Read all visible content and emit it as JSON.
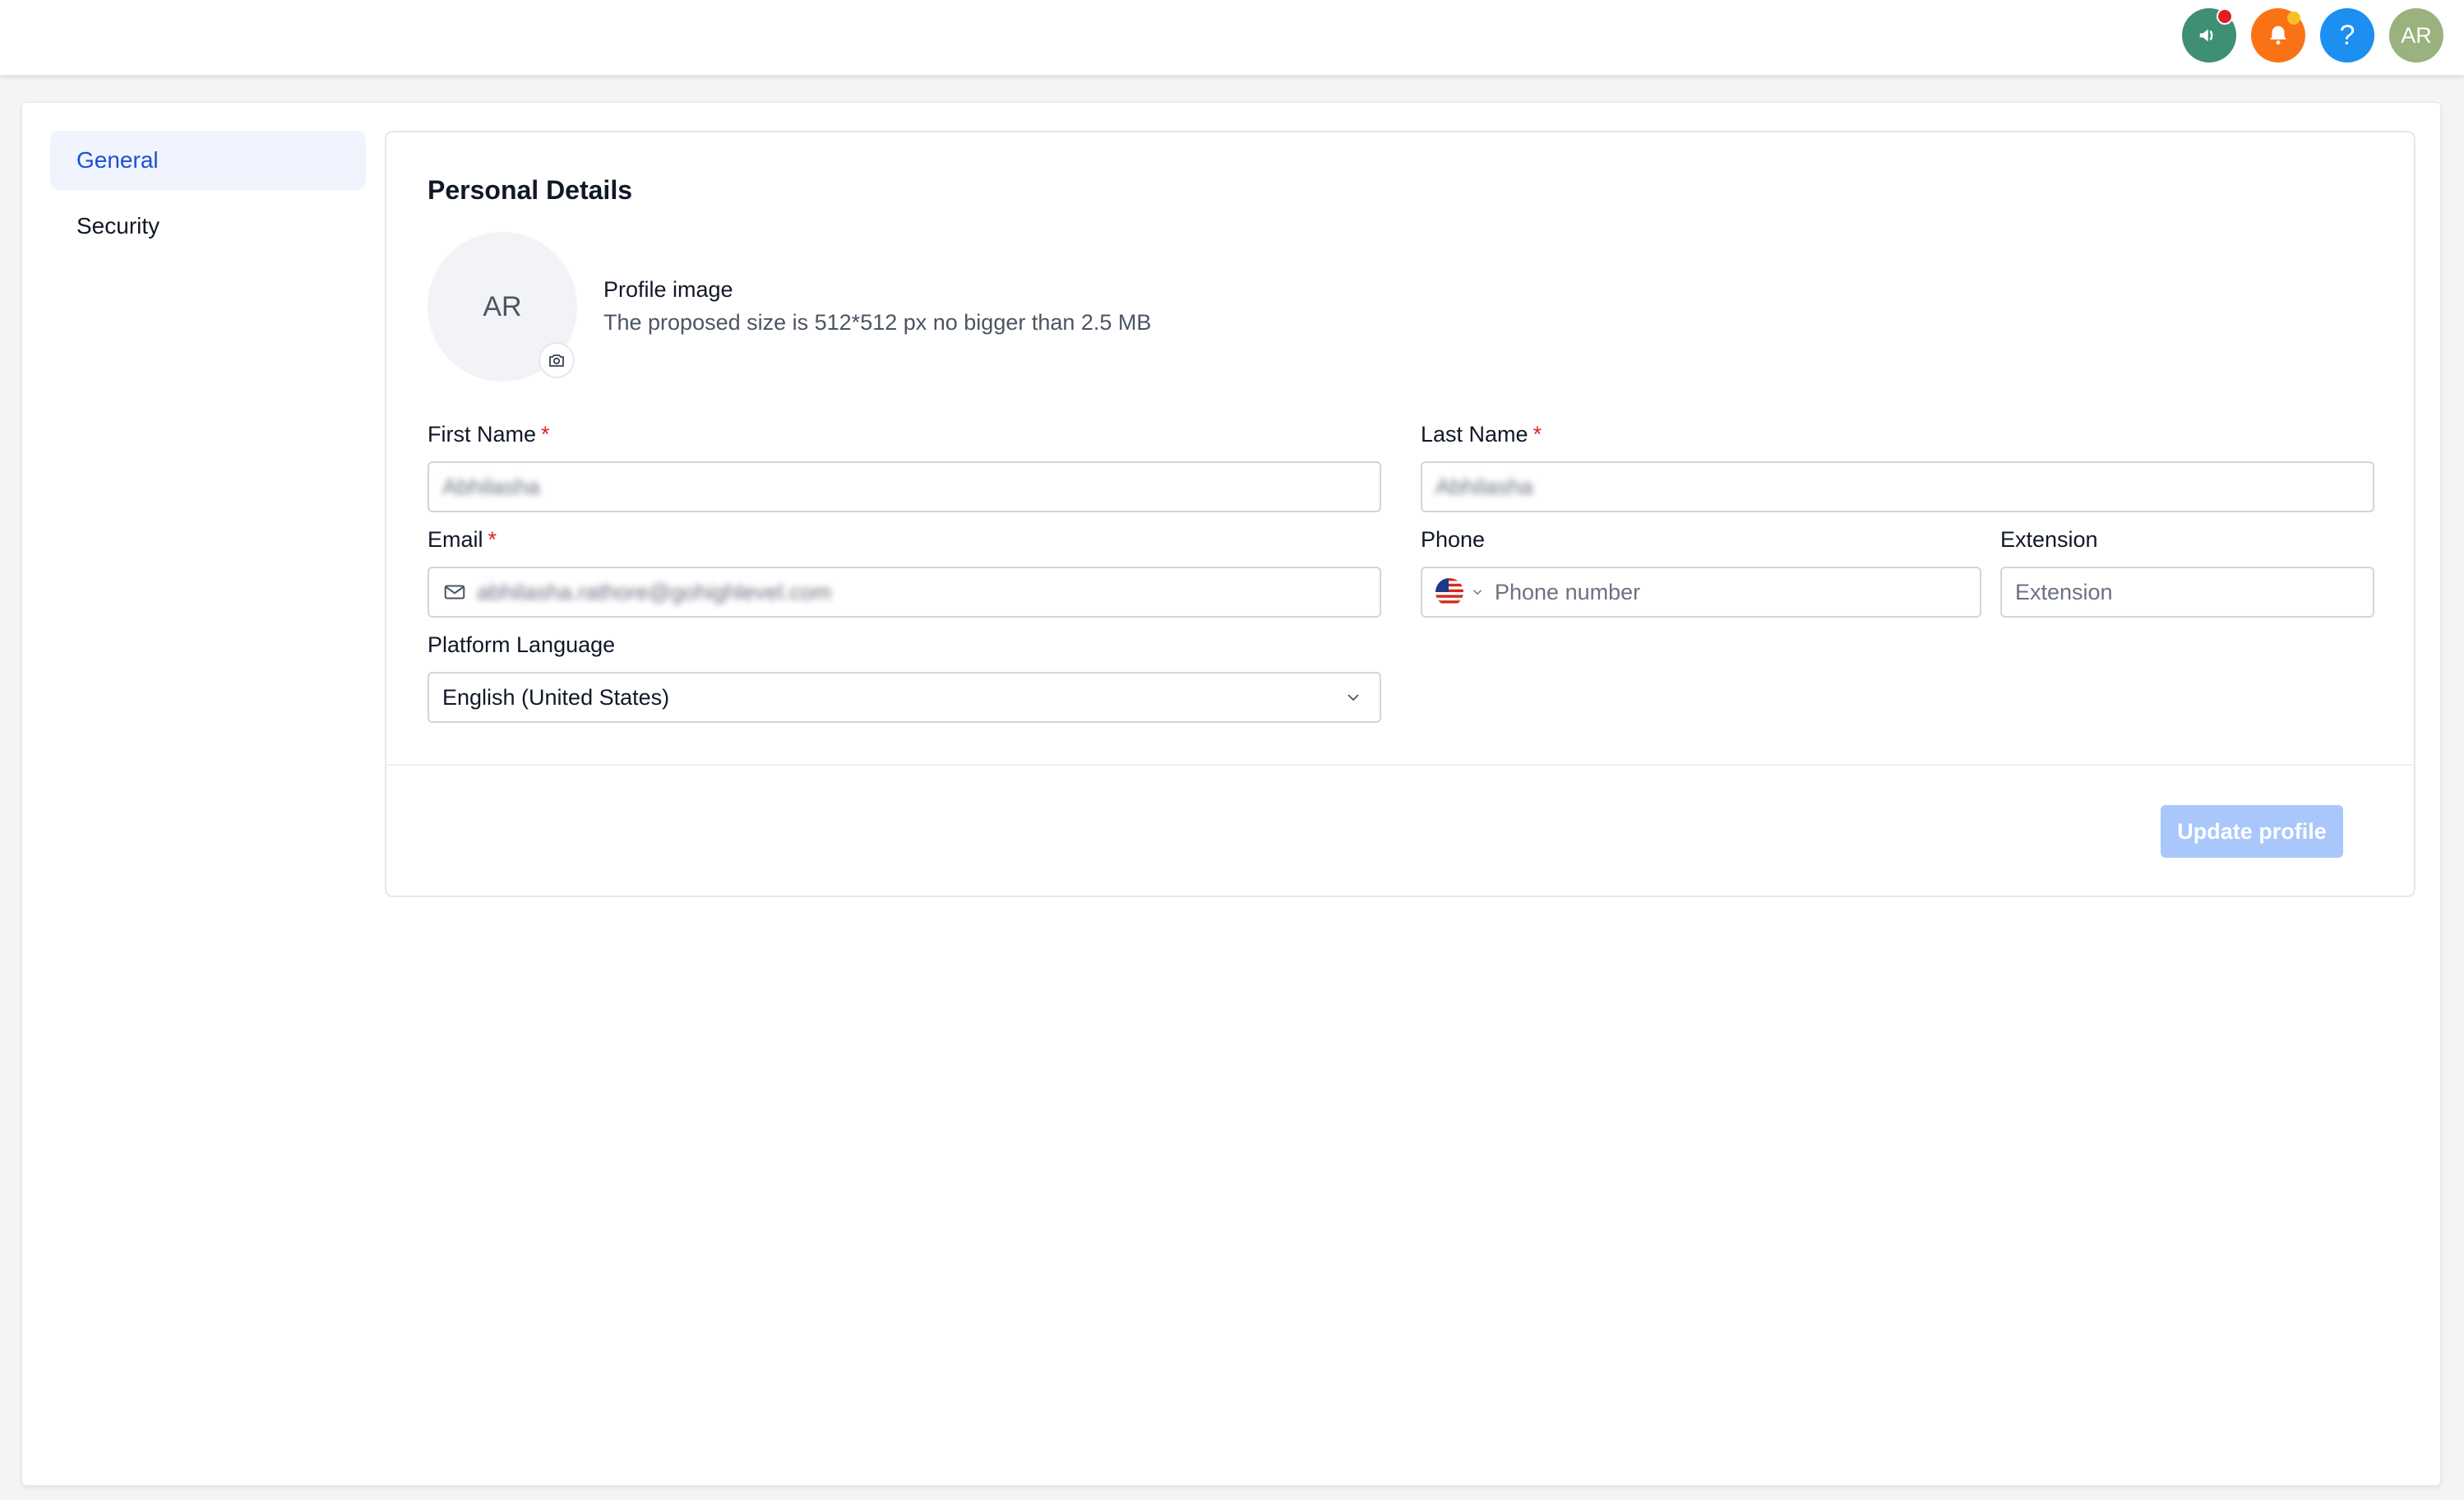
{
  "topbar": {
    "announcement_icon": "megaphone-icon",
    "notification_icon": "bell-icon",
    "help_label": "?",
    "avatar_initials": "AR"
  },
  "sidebar": {
    "items": [
      {
        "label": "General",
        "active": true
      },
      {
        "label": "Security",
        "active": false
      }
    ]
  },
  "personal_details": {
    "title": "Personal Details",
    "avatar_initials": "AR",
    "profile_image_label": "Profile image",
    "profile_image_hint": "The proposed size is 512*512 px no bigger than 2.5 MB",
    "first_name": {
      "label": "First Name",
      "required_mark": "*",
      "value": "Abhilasha"
    },
    "last_name": {
      "label": "Last Name",
      "required_mark": "*",
      "value": "Abhilasha"
    },
    "email": {
      "label": "Email",
      "required_mark": "*",
      "value": "abhilasha.rathore@gohighlevel.com"
    },
    "phone": {
      "label": "Phone",
      "placeholder": "Phone number",
      "country": "US"
    },
    "extension": {
      "label": "Extension",
      "placeholder": "Extension"
    },
    "platform_language": {
      "label": "Platform Language",
      "value": "English (United States)"
    },
    "update_button": "Update profile"
  },
  "colors": {
    "accent": "#1d4ed8",
    "button_disabled": "#a9c7fb",
    "required": "#dc2626"
  }
}
